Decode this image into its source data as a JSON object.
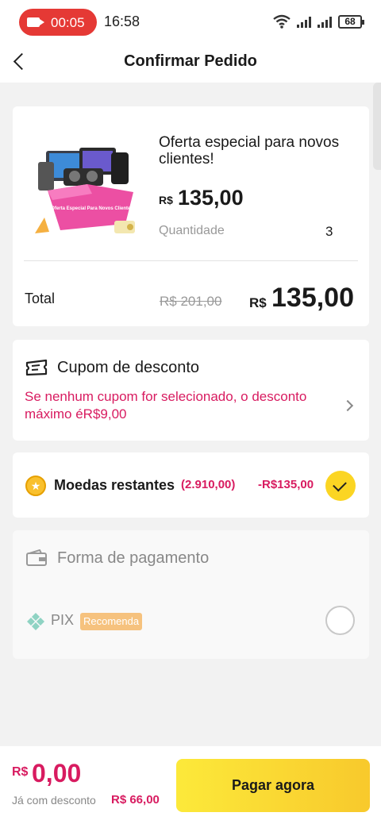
{
  "status_bar": {
    "recording_time": "00:05",
    "clock": "16:58",
    "battery": "68"
  },
  "header": {
    "title": "Confirmar Pedido"
  },
  "product": {
    "image_caption": "Oferta Especial Para Novos Clientes",
    "title": "Oferta especial para novos clientes!",
    "currency": "R$",
    "price": "135,00",
    "quantity_label": "Quantidade",
    "quantity": "3"
  },
  "totals": {
    "label": "Total",
    "original_price": "R$ 201,00",
    "currency": "R$",
    "final_price": "135,00"
  },
  "coupon": {
    "title": "Cupom de desconto",
    "message": "Se nenhum cupom for selecionado, o desconto máximo éR$9,00"
  },
  "coins": {
    "label": "Moedas restantes",
    "balance": "(2.910,00)",
    "discount": "-R$135,00",
    "selected": true
  },
  "payment": {
    "title": "Forma de pagamento",
    "method": "PIX",
    "badge": "Recomenda",
    "selected": false
  },
  "bottom_bar": {
    "currency": "R$",
    "amount": "0,00",
    "discount_label": "Já com desconto",
    "discount_value": "R$ 66,00",
    "pay_button": "Pagar agora"
  },
  "colors": {
    "accent": "#d81b60",
    "button": "#f8d32f",
    "recording": "#e53935"
  }
}
